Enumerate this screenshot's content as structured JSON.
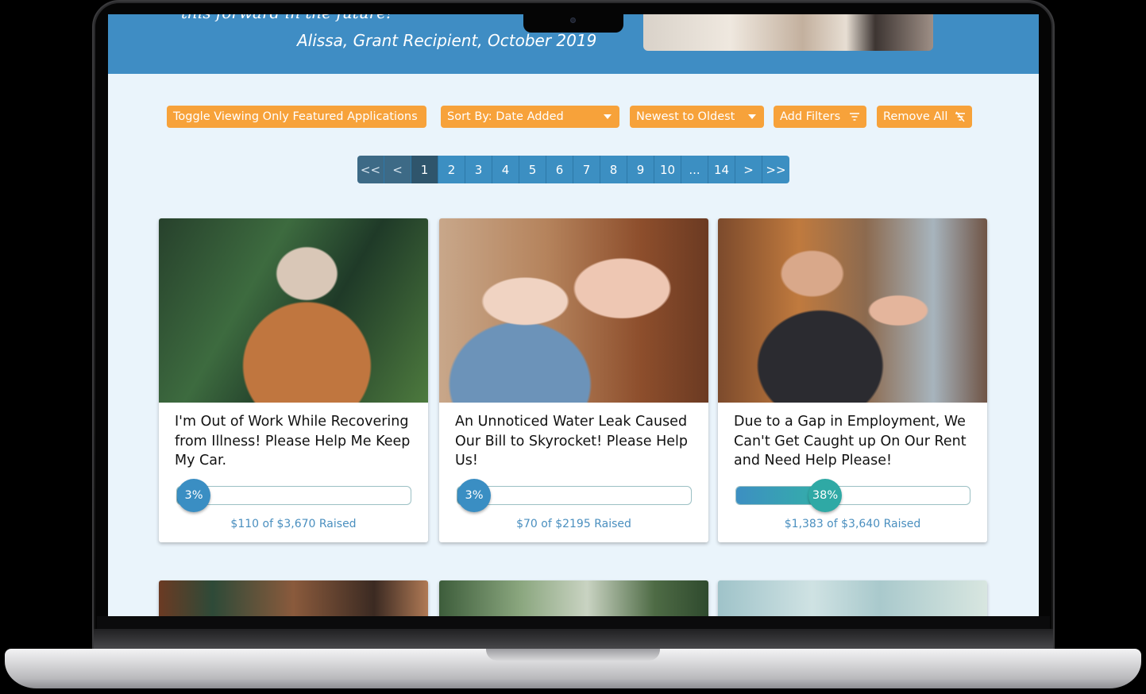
{
  "banner": {
    "quote_partial": "this forward in the future!",
    "author": "Alissa, Grant Recipient, October 2019"
  },
  "controls": {
    "featured_toggle": "Toggle Viewing Only Featured Applications",
    "sort_by": "Sort By: Date Added",
    "order": "Newest to Oldest",
    "add_filters": "Add Filters",
    "remove_all": "Remove All"
  },
  "pagination": {
    "first": "<<",
    "prev": "<",
    "pages": [
      "1",
      "2",
      "3",
      "4",
      "5",
      "6",
      "7",
      "8",
      "9",
      "10",
      "...",
      "14"
    ],
    "current": "1",
    "next": ">",
    "last": ">>"
  },
  "cards": [
    {
      "title": "I'm Out of Work While Recovering from Illness! Please Help Me Keep My Car.",
      "percent_label": "3%",
      "progress": 0.03,
      "raised": "$110 of $3,670 Raised"
    },
    {
      "title": "An Unnoticed Water Leak Caused Our Bill to Skyrocket! Please Help Us!",
      "percent_label": "3%",
      "progress": 0.03,
      "raised": "$70 of $2195 Raised"
    },
    {
      "title": "Due to a Gap in Employment, We Can't Get Caught up On Our Rent and Need Help Please!",
      "percent_label": "38%",
      "progress": 0.38,
      "raised": "$1,383 of $3,640 Raised"
    }
  ],
  "colors": {
    "banner": "#3f8dc4",
    "page_bg": "#eaf4fb",
    "accent_orange": "#f7a23a",
    "pager_blue": "#3c8fc2",
    "progress_teal": "#2fa9a5"
  }
}
